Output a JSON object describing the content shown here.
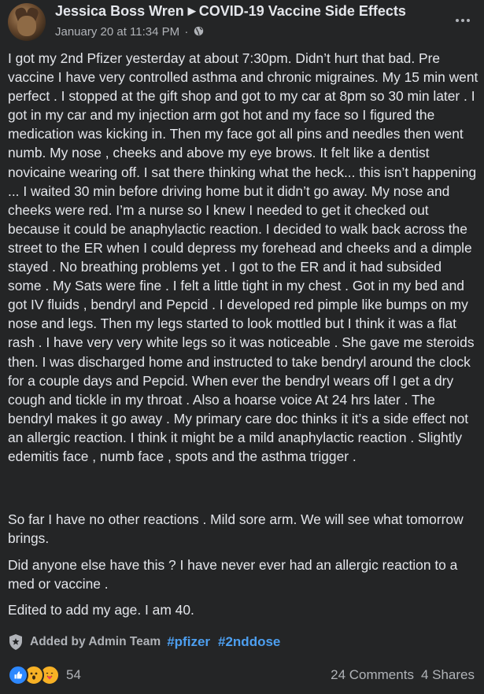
{
  "header": {
    "author": "Jessica Boss Wren",
    "group": "COVID-19 Vaccine Side Effects",
    "timestamp": "January 20 at 11:34 PM",
    "separator": "·",
    "privacy_icon": "globe-icon",
    "more_icon": "more-options-icon"
  },
  "post": {
    "paragraph1": "I got my 2nd Pfizer yesterday at about 7:30pm.  Didn’t hurt that bad. Pre vaccine I have very controlled asthma and chronic migraines. My 15 min went perfect . I stopped at the gift shop and got to my car at 8pm so 30 min later .  I got in my car and my injection arm got hot and my face so I figured the medication was kicking in.  Then my face got all pins and needles then went numb. My nose , cheeks and above my eye brows. It felt like a dentist novicaine wearing off. I sat there thinking what the heck... this isn’t happening ... I waited 30 min before driving home but it didn’t go away. My nose and cheeks were red.  I’m a nurse so I knew I needed to get it checked out because it could be anaphylactic reaction.  I decided to walk back across the street to the ER when I could depress my forehead and cheeks and a dimple stayed .  No breathing problems yet . I got to the ER and it had subsided some . My Sats were fine .  I felt a little tight in my chest . Got in my bed and got IV fluids , bendryl and Pepcid .   I developed red pimple like bumps on my nose and legs. Then my legs started to look mottled but I think it was a flat rash  . I have very very white legs so it was noticeable .  She gave me steroids then.  I was discharged home and instructed to take bendryl around the clock for a couple days and Pepcid.  When ever the bendryl wears off I get a dry cough and tickle in my throat . Also a hoarse voice At 24 hrs later . The bendryl makes it go away .  My primary care doc thinks it it’s a side effect not an allergic reaction.  I think it might be a mild anaphylactic reaction . Slightly edemitis face , numb face , spots and the asthma trigger .",
    "paragraph2": "So far I have no other reactions . Mild sore arm. We will see what tomorrow brings.",
    "paragraph3": "Did anyone else have this ? I have never ever had an allergic reaction to a med or vaccine .",
    "paragraph4": "Edited to add my age. I am 40."
  },
  "topics": {
    "added_by": "Added by Admin Team",
    "tags": [
      "#pfizer",
      "#2nddose"
    ],
    "icon": "shield-icon"
  },
  "footer": {
    "reactions": [
      "like-icon",
      "wow-icon",
      "care-icon"
    ],
    "reaction_count": "54",
    "comments": "24 Comments",
    "shares": "4 Shares"
  },
  "colors": {
    "background": "#242526",
    "text": "#e4e6eb",
    "secondary": "#b0b3b8",
    "link": "#4d9ff0"
  }
}
